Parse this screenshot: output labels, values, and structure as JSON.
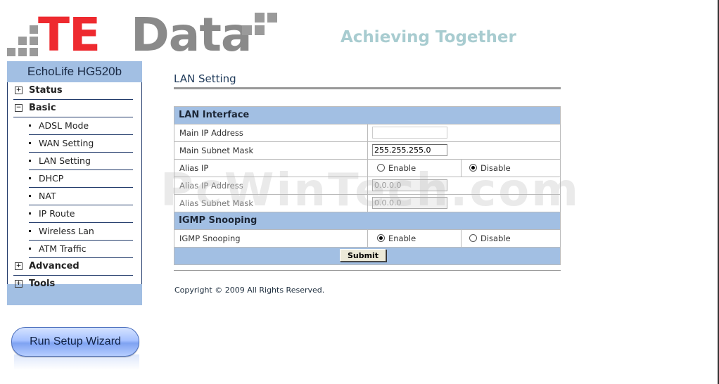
{
  "brand": {
    "logo_te": "TE",
    "logo_data": "Data",
    "tagline": "Achieving Together",
    "colors": {
      "te_red": "#ee2a2f",
      "data_gray": "#8a8a8a",
      "tagline": "#a8ccd0",
      "nav_blue": "#a2bfe3"
    }
  },
  "sidebar": {
    "device_name": "EchoLife HG520b",
    "items": [
      {
        "label": "Status",
        "icon": "plus-box-icon",
        "symbol": "+"
      },
      {
        "label": "Basic",
        "icon": "minus-box-icon",
        "symbol": "−"
      },
      {
        "label": "ADSL Mode"
      },
      {
        "label": "WAN Setting"
      },
      {
        "label": "LAN Setting"
      },
      {
        "label": "DHCP"
      },
      {
        "label": "NAT"
      },
      {
        "label": "IP Route"
      },
      {
        "label": "Wireless Lan"
      },
      {
        "label": "ATM Traffic"
      },
      {
        "label": "Advanced",
        "icon": "plus-box-icon",
        "symbol": "+"
      },
      {
        "label": "Tools",
        "icon": "plus-box-icon",
        "symbol": "+"
      }
    ],
    "wizard_label": "Run Setup Wizard"
  },
  "main": {
    "title": "LAN Setting",
    "lan_interface": {
      "heading": "LAN Interface",
      "main_ip_label": "Main IP Address",
      "main_ip_value": "",
      "subnet_label": "Main Subnet Mask",
      "subnet_value": "255.255.255.0",
      "alias_label": "Alias IP",
      "alias_enable": "Enable",
      "alias_disable": "Disable",
      "alias_ip_label": "Alias IP Address",
      "alias_ip_value": "0.0.0.0",
      "alias_mask_label": "Alias Subnet Mask",
      "alias_mask_value": "0.0.0.0"
    },
    "igmp": {
      "heading": "IGMP Snooping",
      "label": "IGMP Snooping",
      "enable": "Enable",
      "disable": "Disable"
    },
    "submit_label": "Submit",
    "copyright": "Copyright © 2009 All Rights Reserved."
  },
  "watermark": "PcWinTech.com"
}
